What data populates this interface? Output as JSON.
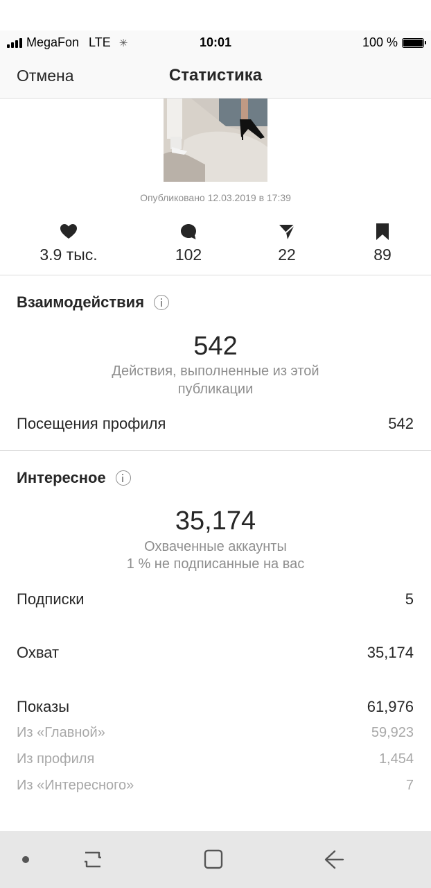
{
  "status_bar": {
    "carrier": "MegaFon",
    "network": "LTE",
    "time": "10:01",
    "battery": "100 %"
  },
  "nav": {
    "cancel_label": "Отмена",
    "title": "Статистика"
  },
  "post": {
    "published": "Опубликовано 12.03.2019 в 17:39"
  },
  "stats": {
    "likes": "3.9 тыс.",
    "comments": "102",
    "shares": "22",
    "saves": "89"
  },
  "interactions": {
    "title": "Взаимодействия",
    "total": "542",
    "caption_line1": "Действия, выполненные из этой",
    "caption_line2": "публикации",
    "rows": [
      {
        "label": "Посещения профиля",
        "value": "542"
      }
    ]
  },
  "discovery": {
    "title": "Интересное",
    "total": "35,174",
    "caption_line1": "Охваченные аккаунты",
    "caption_line2": "1 % не подписанные на вас",
    "rows": [
      {
        "label": "Подписки",
        "value": "5"
      },
      {
        "label": "Охват",
        "value": "35,174"
      },
      {
        "label": "Показы",
        "value": "61,976"
      }
    ],
    "sub_rows": [
      {
        "label": "Из «Главной»",
        "value": "59,923"
      },
      {
        "label": "Из профиля",
        "value": "1,454"
      },
      {
        "label": "Из «Интересного»",
        "value": "7"
      }
    ]
  },
  "colors": {
    "text": "#262626",
    "muted": "#8e8e8e",
    "divider": "#dbdbdb"
  }
}
